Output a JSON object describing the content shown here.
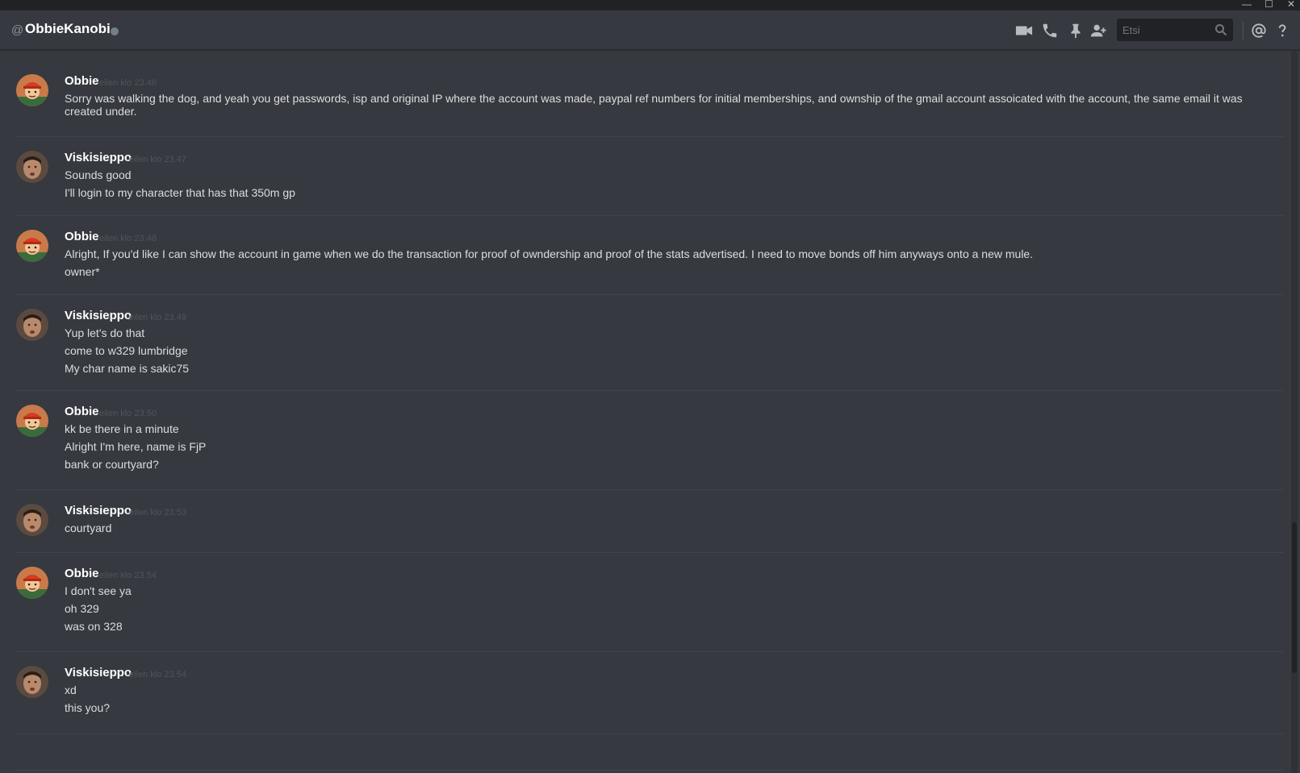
{
  "window": {
    "minimize": "—",
    "maximize": "☐",
    "close": "✕"
  },
  "header": {
    "at_symbol": "@",
    "title": "ObbieKanobi",
    "search_placeholder": "Etsi"
  },
  "icons": [
    "video-icon",
    "phone-icon",
    "pin-icon",
    "add-friend-icon",
    "search-icon",
    "mention-icon",
    "help-icon"
  ],
  "colors": {
    "background": "#36393f",
    "header": "#36393f",
    "author": "#ffffff",
    "timestamp": "#4f545c",
    "text": "#dcddde"
  },
  "messages": [
    {
      "author": "Obbie",
      "time": "eilen klo 23.46",
      "avatar": "obbie",
      "lines": [
        "Sorry was walking the dog, and yeah you get passwords, isp and original IP where the account was made, paypal ref numbers for initial memberships, and ownship of the gmail account assoicated with the account, the same email it was created under."
      ]
    },
    {
      "author": "Viskisieppo",
      "time": "eilen klo 23.47",
      "avatar": "viski",
      "lines": [
        "Sounds good",
        "I'll login to my character that has that 350m gp"
      ]
    },
    {
      "author": "Obbie",
      "time": "eilen klo 23.48",
      "avatar": "obbie",
      "lines": [
        "Alright, If you'd like I can show the account in game when we do the transaction for proof of owndership and proof of the stats advertised. I need to move bonds off him anyways onto a new mule.",
        "owner*"
      ]
    },
    {
      "author": "Viskisieppo",
      "time": "eilen klo 23.49",
      "avatar": "viski",
      "lines": [
        "Yup let's do that",
        "come to w329 lumbridge",
        "My char name is sakic75"
      ]
    },
    {
      "author": "Obbie",
      "time": "eilen klo 23.50",
      "avatar": "obbie",
      "lines": [
        "kk be there in a minute",
        "Alright I'm here, name is FjP",
        "bank or courtyard?"
      ]
    },
    {
      "author": "Viskisieppo",
      "time": "eilen klo 23.53",
      "avatar": "viski",
      "lines": [
        "courtyard"
      ]
    },
    {
      "author": "Obbie",
      "time": "eilen klo 23.54",
      "avatar": "obbie",
      "lines": [
        "I don't see ya",
        "oh 329",
        "was on 328"
      ]
    },
    {
      "author": "Viskisieppo",
      "time": "eilen klo 23.54",
      "avatar": "viski",
      "lines": [
        "xd",
        "this you?"
      ]
    }
  ]
}
